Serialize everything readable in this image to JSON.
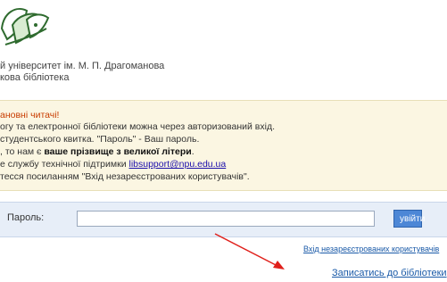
{
  "header": {
    "university_line": "й університет ім. М. П. Драгоманова",
    "library_line": "кова бібліотека"
  },
  "notice": {
    "greeting": "ановні читачі!",
    "line1": "огу та електронної бібліотеки можна через авторизований вхід.",
    "line2": "студентського квитка.   \"Пароль\" - Ваш пароль.",
    "line3_prefix": ", то нам є ",
    "line3_bold": "ваше прізвище з великої літери",
    "line3_suffix": ".",
    "line4_prefix": "е службу технічної підтримки ",
    "support_email": "libsupport@npu.edu.ua",
    "line5": "тесся посиланням \"Вхід незареєстрованих користувачів\"."
  },
  "login": {
    "password_label": "Пароль:",
    "password_value": "",
    "submit_label": "увійти"
  },
  "links": {
    "guest_login": "Вхід незареєстрованих користувачів",
    "signup": "Записатись до бібліотеки"
  },
  "colors": {
    "notice_bg": "#fbf6e2",
    "login_bar_bg": "#e7eef8",
    "button_bg": "#4d87d6",
    "arrow": "#e0201b"
  }
}
